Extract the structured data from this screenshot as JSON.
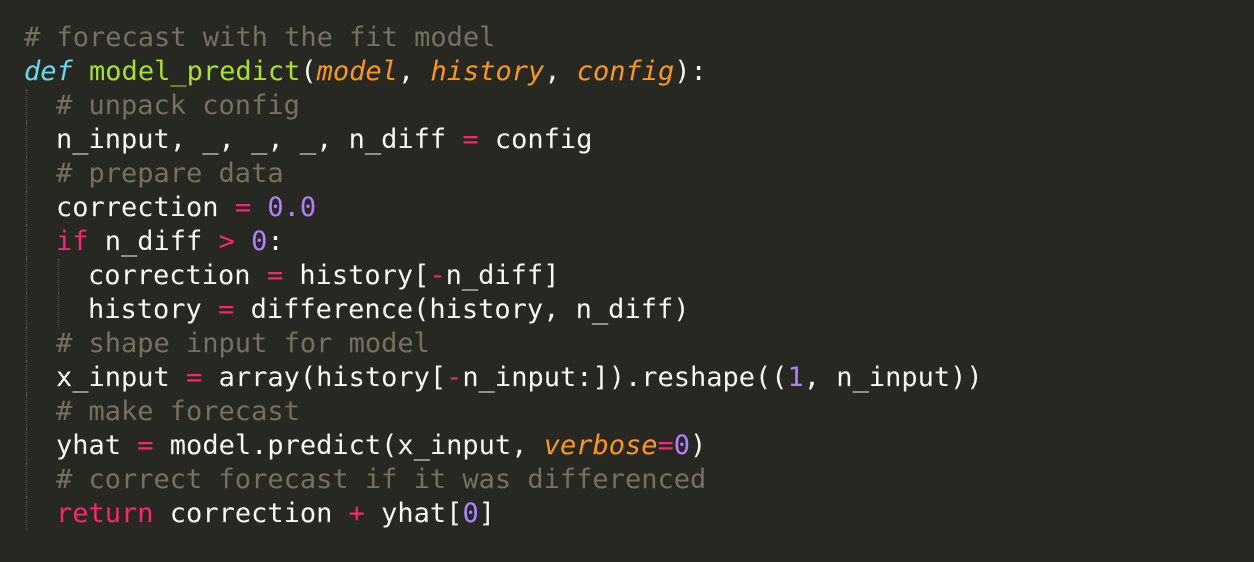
{
  "colors": {
    "background": "#272822",
    "comment": "#75715e",
    "keyword": "#f92672",
    "storage": "#66d9ef",
    "function_name": "#a6e22e",
    "parameter": "#fd971f",
    "number": "#ae81ff",
    "plain": "#f8f8f2"
  },
  "code": {
    "lines": [
      {
        "indent": 0,
        "tokens": [
          {
            "t": "# forecast with the fit model",
            "k": "comment"
          }
        ]
      },
      {
        "indent": 0,
        "tokens": [
          {
            "t": "def",
            "k": "storage",
            "italic": true
          },
          {
            "t": " ",
            "k": "plain"
          },
          {
            "t": "model_predict",
            "k": "function_name"
          },
          {
            "t": "(",
            "k": "plain"
          },
          {
            "t": "model",
            "k": "parameter",
            "italic": true
          },
          {
            "t": ", ",
            "k": "plain"
          },
          {
            "t": "history",
            "k": "parameter",
            "italic": true
          },
          {
            "t": ", ",
            "k": "plain"
          },
          {
            "t": "config",
            "k": "parameter",
            "italic": true
          },
          {
            "t": "):",
            "k": "plain"
          }
        ]
      },
      {
        "indent": 1,
        "tokens": [
          {
            "t": "# unpack config",
            "k": "comment"
          }
        ]
      },
      {
        "indent": 1,
        "tokens": [
          {
            "t": "n_input, _, _, _, n_diff ",
            "k": "plain"
          },
          {
            "t": "=",
            "k": "keyword"
          },
          {
            "t": " config",
            "k": "plain"
          }
        ]
      },
      {
        "indent": 1,
        "tokens": [
          {
            "t": "# prepare data",
            "k": "comment"
          }
        ]
      },
      {
        "indent": 1,
        "tokens": [
          {
            "t": "correction ",
            "k": "plain"
          },
          {
            "t": "=",
            "k": "keyword"
          },
          {
            "t": " ",
            "k": "plain"
          },
          {
            "t": "0.0",
            "k": "number"
          }
        ]
      },
      {
        "indent": 1,
        "tokens": [
          {
            "t": "if",
            "k": "keyword"
          },
          {
            "t": " n_diff ",
            "k": "plain"
          },
          {
            "t": ">",
            "k": "keyword"
          },
          {
            "t": " ",
            "k": "plain"
          },
          {
            "t": "0",
            "k": "number"
          },
          {
            "t": ":",
            "k": "plain"
          }
        ]
      },
      {
        "indent": 2,
        "tokens": [
          {
            "t": "correction ",
            "k": "plain"
          },
          {
            "t": "=",
            "k": "keyword"
          },
          {
            "t": " history[",
            "k": "plain"
          },
          {
            "t": "-",
            "k": "keyword"
          },
          {
            "t": "n_diff]",
            "k": "plain"
          }
        ]
      },
      {
        "indent": 2,
        "tokens": [
          {
            "t": "history ",
            "k": "plain"
          },
          {
            "t": "=",
            "k": "keyword"
          },
          {
            "t": " difference(history, n_diff)",
            "k": "plain"
          }
        ]
      },
      {
        "indent": 1,
        "tokens": [
          {
            "t": "# shape input for model",
            "k": "comment"
          }
        ]
      },
      {
        "indent": 1,
        "tokens": [
          {
            "t": "x_input ",
            "k": "plain"
          },
          {
            "t": "=",
            "k": "keyword"
          },
          {
            "t": " array(history[",
            "k": "plain"
          },
          {
            "t": "-",
            "k": "keyword"
          },
          {
            "t": "n_input:]).reshape((",
            "k": "plain"
          },
          {
            "t": "1",
            "k": "number"
          },
          {
            "t": ", n_input))",
            "k": "plain"
          }
        ]
      },
      {
        "indent": 1,
        "tokens": [
          {
            "t": "# make forecast",
            "k": "comment"
          }
        ]
      },
      {
        "indent": 1,
        "tokens": [
          {
            "t": "yhat ",
            "k": "plain"
          },
          {
            "t": "=",
            "k": "keyword"
          },
          {
            "t": " model.predict(x_input, ",
            "k": "plain"
          },
          {
            "t": "verbose",
            "k": "parameter",
            "italic": true
          },
          {
            "t": "=",
            "k": "keyword"
          },
          {
            "t": "0",
            "k": "number"
          },
          {
            "t": ")",
            "k": "plain"
          }
        ]
      },
      {
        "indent": 1,
        "tokens": [
          {
            "t": "# correct forecast if it was differenced",
            "k": "comment"
          }
        ]
      },
      {
        "indent": 1,
        "tokens": [
          {
            "t": "return",
            "k": "keyword"
          },
          {
            "t": " correction ",
            "k": "plain"
          },
          {
            "t": "+",
            "k": "keyword"
          },
          {
            "t": " yhat[",
            "k": "plain"
          },
          {
            "t": "0",
            "k": "number"
          },
          {
            "t": "]",
            "k": "plain"
          }
        ]
      }
    ]
  }
}
